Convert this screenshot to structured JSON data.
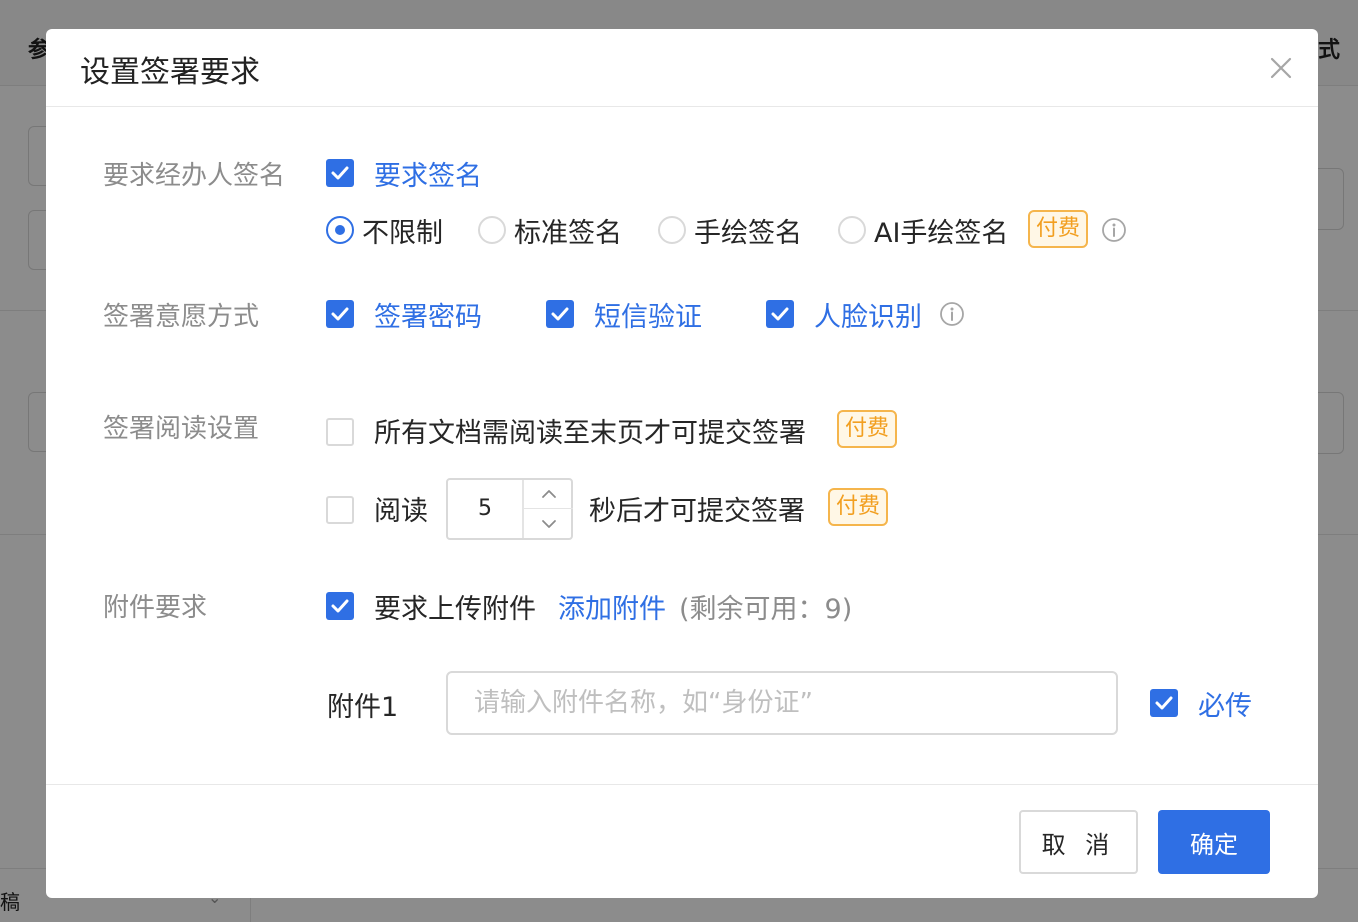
{
  "background": {
    "left_title": "参",
    "right_title": "式",
    "bottom_text": "稿",
    "bottom_chevron": "chevron-down-icon"
  },
  "modal": {
    "title": "设置签署要求",
    "close_icon": "close-icon"
  },
  "signature": {
    "label": "要求经办人签名",
    "require_checkbox": {
      "label": "要求签名",
      "checked": true
    },
    "options": [
      {
        "label": "不限制",
        "selected": true
      },
      {
        "label": "标准签名",
        "selected": false
      },
      {
        "label": "手绘签名",
        "selected": false
      },
      {
        "label": "AI手绘签名",
        "selected": false
      }
    ],
    "paid_badge": "付费"
  },
  "intention": {
    "label": "签署意愿方式",
    "options": [
      {
        "label": "签署密码",
        "checked": true
      },
      {
        "label": "短信验证",
        "checked": true
      },
      {
        "label": "人脸识别",
        "checked": true
      }
    ]
  },
  "reading": {
    "label": "签署阅读设置",
    "read_to_end": {
      "label": "所有文档需阅读至末页才可提交签署",
      "checked": false,
      "badge": "付费"
    },
    "read_seconds": {
      "prefix": "阅读",
      "value": "5",
      "suffix": "秒后才可提交签署",
      "checked": false,
      "badge": "付费"
    }
  },
  "attachment": {
    "label": "附件要求",
    "require": {
      "label": "要求上传附件",
      "checked": true
    },
    "add_link": "添加附件",
    "remaining": "(剩余可用：9)",
    "item": {
      "label": "附件1",
      "placeholder": "请输入附件名称，如“身份证”",
      "required": {
        "label": "必传",
        "checked": true
      }
    }
  },
  "footer": {
    "cancel": "取 消",
    "ok": "确定"
  },
  "colors": {
    "primary": "#2f6fe4",
    "badge_border": "#f5b54c",
    "badge_text": "#f29f20"
  }
}
